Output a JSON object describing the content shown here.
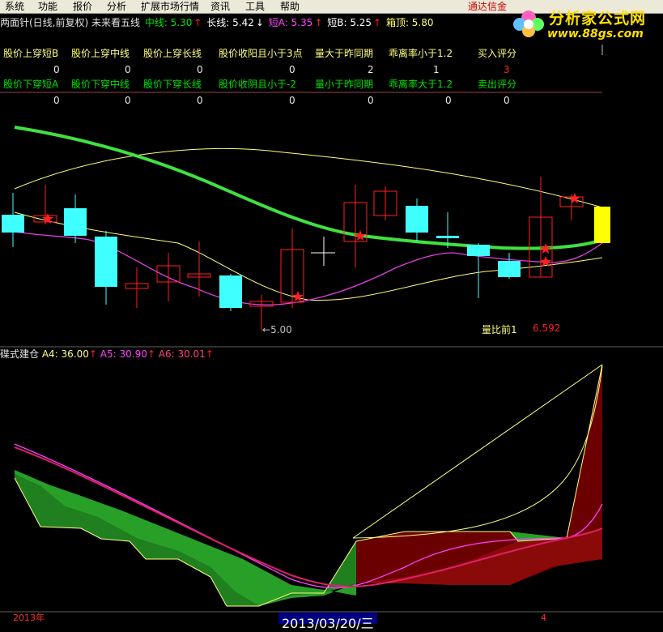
{
  "menu": {
    "items": [
      "系统",
      "功能",
      "报价",
      "分析",
      "扩展市场行情",
      "资讯",
      "工具",
      "帮助"
    ],
    "right_text": "通达信金"
  },
  "logo": {
    "cn": "分析家公式网",
    "url": "www.88gs.com"
  },
  "title": {
    "name": "两面针(日线,前复权) 未来看五线",
    "mid_label": "中线: 5.30",
    "long_label": "长线: 5.42",
    "shortA_label": "短A: 5.35",
    "shortB_label": "短B: 5.25",
    "box_label": "箱顶: 5.80"
  },
  "table": {
    "buy_headers": [
      "股价上穿短B",
      "股价上穿中线",
      "股价上穿长线",
      "股价收阳且小于3点",
      "量大于昨同期",
      "乖离率小于1.2",
      "买入评分"
    ],
    "buy_values": [
      "0",
      "0",
      "0",
      "0",
      "2",
      "1",
      "3"
    ],
    "sell_headers": [
      "股价下穿短A",
      "股价下穿中线",
      "股价下穿长线",
      "股价收阴且小于-2",
      "量小于昨同期",
      "乖离率大于1.2",
      "卖出评分"
    ],
    "sell_values": [
      "0",
      "0",
      "0",
      "0",
      "0",
      "0",
      "0"
    ]
  },
  "price_chart": {
    "low_label": "5.00",
    "vol_ratio_label": "量比前1",
    "vol_ratio_value": "6.592"
  },
  "indicator": {
    "name": "碟式建仓",
    "a4": "A4: 36.00",
    "a5": "A5: 30.90",
    "a6": "A6: 30.01"
  },
  "xaxis": {
    "start": "2013年",
    "cursor_date": "2013/03/20/三",
    "mark": "4"
  },
  "colors": {
    "up": "#ff2020",
    "down": "#40ffff",
    "mid_line": "#40e040",
    "long_line": "#ffff80",
    "short_a": "#ff40ff",
    "short_b": "#ffff80"
  }
}
